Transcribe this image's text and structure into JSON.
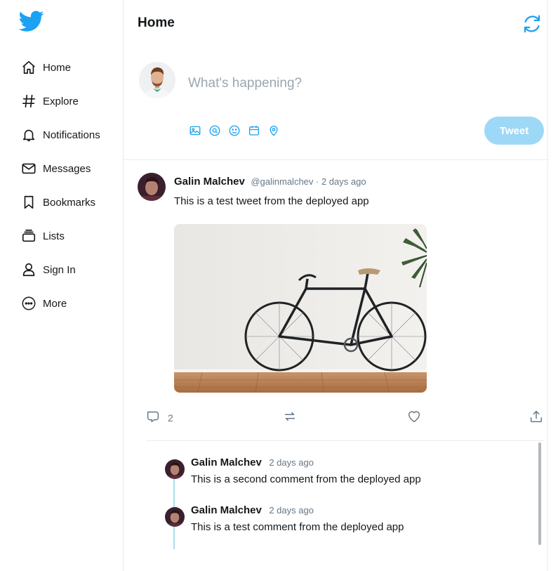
{
  "sidebar": {
    "logo": "twitter-bird-icon",
    "items": [
      {
        "label": "Home",
        "icon": "home-icon"
      },
      {
        "label": "Explore",
        "icon": "hashtag-icon"
      },
      {
        "label": "Notifications",
        "icon": "bell-icon"
      },
      {
        "label": "Messages",
        "icon": "envelope-icon"
      },
      {
        "label": "Bookmarks",
        "icon": "bookmark-icon"
      },
      {
        "label": "Lists",
        "icon": "lists-icon"
      },
      {
        "label": "Sign In",
        "icon": "user-icon"
      },
      {
        "label": "More",
        "icon": "more-circle-icon"
      }
    ]
  },
  "header": {
    "title": "Home",
    "refresh_icon": "refresh-icon"
  },
  "compose": {
    "placeholder": "What's happening?",
    "value": "",
    "tools": [
      "image-icon",
      "gif-search-icon",
      "emoji-icon",
      "calendar-icon",
      "location-icon"
    ],
    "tweet_label": "Tweet"
  },
  "tweet": {
    "name": "Galin Malchev",
    "handle": "@galinmalchev",
    "time": "2 days ago",
    "meta": "@galinmalchev · 2 days ago",
    "text": "This is a test tweet from the deployed app",
    "reply_count": "2"
  },
  "comments": [
    {
      "name": "Galin Malchev",
      "time": "2 days ago",
      "text": "This is a second comment from the deployed app"
    },
    {
      "name": "Galin Malchev",
      "time": "2 days ago",
      "text": "This is a test comment from the deployed app"
    }
  ],
  "colors": {
    "accent": "#1da1f2",
    "tweet_button_disabled": "#9ed8f7",
    "thread_line": "#a8e0ea",
    "muted_text": "#657786"
  }
}
